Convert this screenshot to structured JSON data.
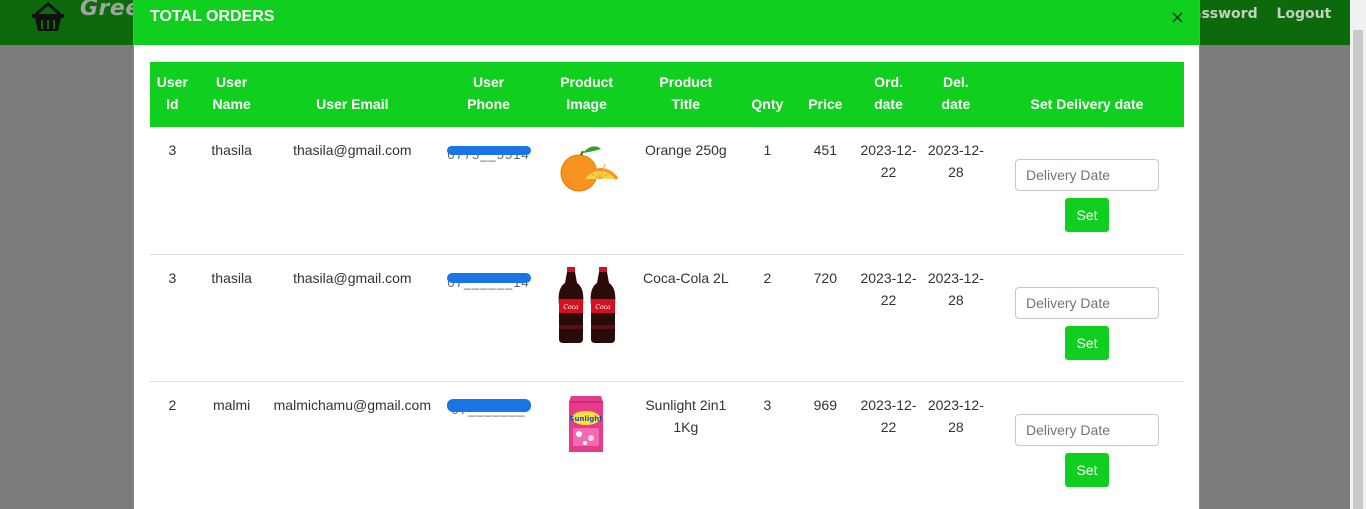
{
  "app": {
    "brand_text": "Gree"
  },
  "nav": {
    "links": [
      "assword",
      "Logout"
    ]
  },
  "modal": {
    "title": "TOTAL ORDERS",
    "close_symbol": "×",
    "headers": [
      "User Id",
      "User Name",
      "User Email",
      "User Phone",
      "Product Image",
      "Product Title",
      "Qnty",
      "Price",
      "Ord. date",
      "Del. date",
      "Set Delivery date"
    ],
    "input_placeholder": "Delivery Date",
    "set_label": "Set",
    "rows": [
      {
        "user_id": "3",
        "user_name": "thasila",
        "email": "thasila@gmail.com",
        "phone_visible": "0775__5514",
        "image": "orange-image",
        "title": "Orange 250g",
        "qty": "1",
        "price": "451",
        "ord_date": "2023-12-22",
        "del_date": "2023-12-28"
      },
      {
        "user_id": "3",
        "user_name": "thasila",
        "email": "thasila@gmail.com",
        "phone_visible": "07______14",
        "image": "coca-cola-bottles-image",
        "title": "Coca-Cola 2L",
        "qty": "2",
        "price": "720",
        "ord_date": "2023-12-22",
        "del_date": "2023-12-28"
      },
      {
        "user_id": "2",
        "user_name": "malmi",
        "email": "malmichamu@gmail.com",
        "phone_visible": "07_______",
        "image": "sunlight-detergent-image",
        "title": "Sunlight 2in1 1Kg",
        "qty": "3",
        "price": "969",
        "ord_date": "2023-12-22",
        "del_date": "2023-12-28"
      }
    ]
  },
  "colors": {
    "accent": "#11cf1f",
    "navbar": "#0c6a0c",
    "overlay": "#7b7b7b",
    "redaction": "#1875e6"
  }
}
